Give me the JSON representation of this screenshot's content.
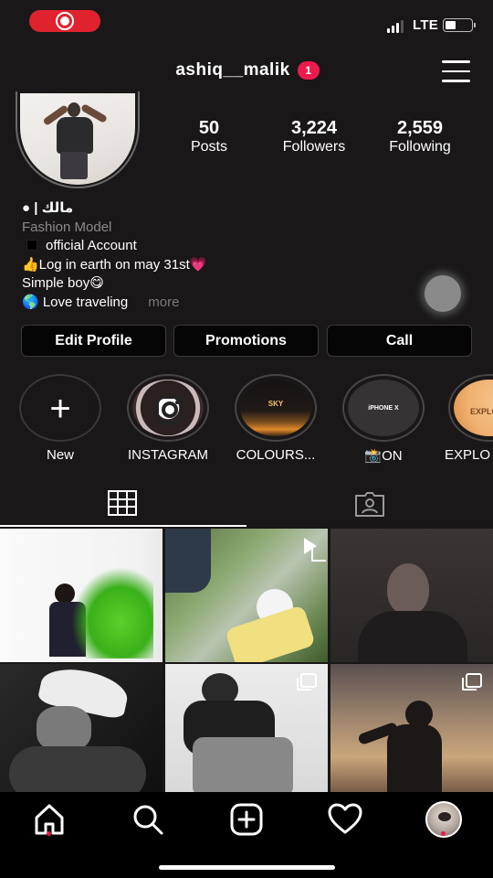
{
  "status_bar": {
    "network": "LTE",
    "signal_bars": 3,
    "battery_level": 0.3
  },
  "header": {
    "username": "ashiq__malik",
    "notification_count": "1"
  },
  "stats": [
    {
      "value": "50",
      "label": "Posts"
    },
    {
      "value": "3,224",
      "label": "Followers"
    },
    {
      "value": "2,559",
      "label": "Following"
    }
  ],
  "bio": {
    "name": " | مالك",
    "category": "Fashion Model",
    "line1": "official Account",
    "line2": "👍Log in earth on may 31st",
    "line2_emoji": "💗",
    "line3": "Simple boy😋",
    "line4": "🌎 Love traveling",
    "more": "more"
  },
  "buttons": {
    "edit_profile": "Edit Profile",
    "promotions": "Promotions",
    "call": "Call"
  },
  "highlights": [
    {
      "label": "New",
      "icon": "plus-icon"
    },
    {
      "label": "INSTAGRAM",
      "icon": "instagram-icon"
    },
    {
      "label": "COLOURS...",
      "cover_text": "SKY"
    },
    {
      "label": "📸ON",
      "cover_text": "iPHONE X"
    },
    {
      "label": "EXPLO",
      "cover_text": "EXPLO"
    }
  ],
  "tabs": [
    {
      "name": "grid",
      "icon": "grid-icon",
      "active": true
    },
    {
      "name": "tagged",
      "icon": "tagged-person-icon",
      "active": false
    }
  ],
  "nav": [
    {
      "name": "home",
      "icon": "home-icon"
    },
    {
      "name": "search",
      "icon": "search-icon"
    },
    {
      "name": "create",
      "icon": "add-post-icon"
    },
    {
      "name": "activity",
      "icon": "heart-icon"
    },
    {
      "name": "profile",
      "icon": "profile-avatar"
    }
  ],
  "colors": {
    "background": "#1a1718",
    "accent_red": "#ed1a4b",
    "record_red": "#e0222f"
  }
}
